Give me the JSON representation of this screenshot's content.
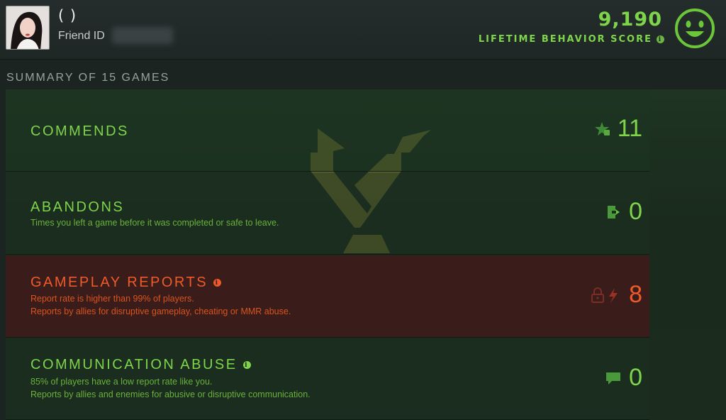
{
  "profile": {
    "name": "( )",
    "friend_id_label": "Friend ID"
  },
  "behavior": {
    "score": "9,190",
    "label": "LIFETIME BEHAVIOR SCORE",
    "info_icon": "info-icon",
    "face_icon": "smiley-face-icon",
    "accent_color": "#7fd54a"
  },
  "summary": {
    "title": "SUMMARY OF 15 GAMES"
  },
  "rows": {
    "commends": {
      "title": "COMMENDS",
      "value": "11",
      "icon": "star-thumb-icon"
    },
    "abandons": {
      "title": "ABANDONS",
      "desc1": "Times you left a game before it was completed or safe to leave.",
      "value": "0",
      "icon": "exit-door-icon"
    },
    "reports": {
      "title": "GAMEPLAY REPORTS",
      "desc1": "Report rate is higher than 99% of players.",
      "desc2": "Reports by allies for disruptive gameplay, cheating or MMR abuse.",
      "value": "8",
      "icon": "lock-lightning-icon",
      "color": "#ee5a2a"
    },
    "comm_abuse": {
      "title": "COMMUNICATION ABUSE",
      "desc1": "85% of players have a low report rate like you.",
      "desc2": "Reports by allies and enemies for abusive or disruptive communication.",
      "value": "0",
      "icon": "chat-bubble-icon"
    }
  }
}
